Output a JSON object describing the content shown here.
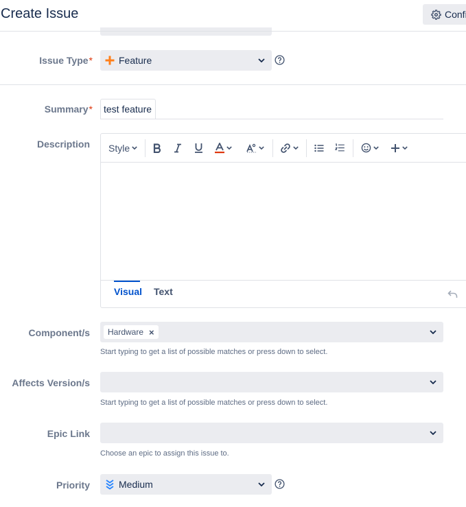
{
  "header": {
    "title": "Create Issue",
    "configure_label": "Confi"
  },
  "fields": {
    "issue_type": {
      "label": "Issue Type",
      "required": "*",
      "value": "Feature"
    },
    "summary": {
      "label": "Summary",
      "required": "*",
      "value": "test feature"
    },
    "description": {
      "label": "Description",
      "toolbar": {
        "style_label": "Style"
      },
      "tabs": [
        {
          "label": "Visual"
        },
        {
          "label": "Text"
        }
      ]
    },
    "components": {
      "label": "Component/s",
      "chips": [
        {
          "label": "Hardware",
          "remove": "×"
        }
      ],
      "hint": "Start typing to get a list of possible matches or press down to select."
    },
    "affects_version": {
      "label": "Affects Version/s",
      "value": "",
      "hint": "Start typing to get a list of possible matches or press down to select."
    },
    "epic_link": {
      "label": "Epic Link",
      "value": "",
      "hint": "Choose an epic to assign this issue to."
    },
    "priority": {
      "label": "Priority",
      "value": "Medium"
    }
  },
  "colors": {
    "accent": "#0052cc",
    "required": "#de350b",
    "feature_icon": "#ff7f1a",
    "priority_icon": "#2684ff",
    "field_bg": "#ebecf0"
  },
  "icons": [
    "gear-icon",
    "plus-icon",
    "help-icon",
    "chevron-down-icon",
    "bold-icon",
    "italic-icon",
    "underline-icon",
    "text-color-icon",
    "text-style-icon",
    "link-icon",
    "bullet-list-icon",
    "numbered-list-icon",
    "emoji-icon",
    "insert-more-icon",
    "undo-icon",
    "priority-medium-icon",
    "close-icon"
  ]
}
